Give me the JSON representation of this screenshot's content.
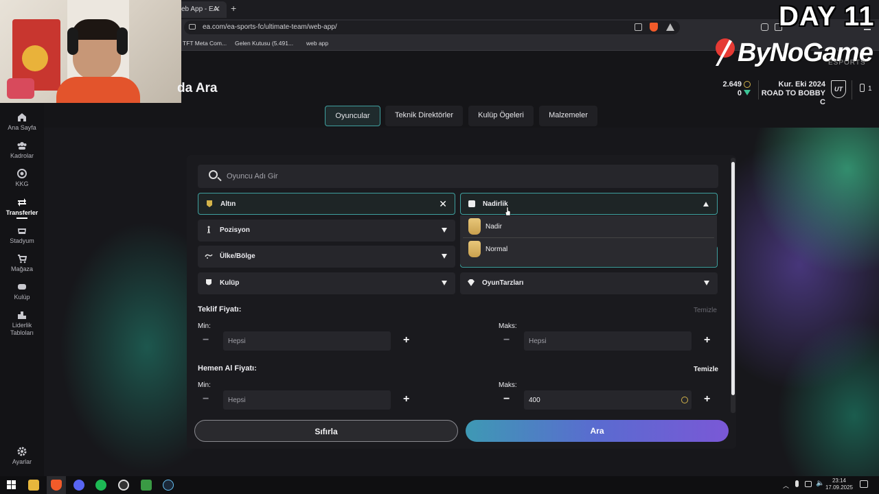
{
  "browser": {
    "tab_title": "eb App - EA",
    "url": "ea.com/ea-sports-fc/ultimate-team/web-app/",
    "bookmarks": [
      "TFT Meta Com...",
      "Gelen Kutusu (5.491...",
      "web app"
    ]
  },
  "overlay": {
    "day_label": "DAY 11",
    "brand": "ByNoGame",
    "brand_sub": "ESPORTS"
  },
  "sidebar": {
    "items": [
      {
        "label": "Ana Sayfa",
        "icon": "home-icon"
      },
      {
        "label": "Kadrolar",
        "icon": "squad-icon"
      },
      {
        "label": "KKG",
        "icon": "sbc-icon"
      },
      {
        "label": "Transferler",
        "icon": "transfer-icon"
      },
      {
        "label": "Stadyum",
        "icon": "stadium-icon"
      },
      {
        "label": "Mağaza",
        "icon": "cart-icon"
      },
      {
        "label": "Kulüp",
        "icon": "club-icon"
      },
      {
        "label": "Liderlik Tabloları",
        "icon": "leaderboard-icon"
      }
    ],
    "settings_label": "Ayarlar"
  },
  "header": {
    "title": "da Ara",
    "coins": "2.649",
    "points": "0",
    "season_line1": "Kur. Eki 2024",
    "season_line2": "ROAD TO BOBBY C",
    "ut_badge": "UT",
    "phone_count": "1"
  },
  "tabs": [
    "Oyuncular",
    "Teknik Direktörler",
    "Kulüp Ögeleri",
    "Malzemeler"
  ],
  "search": {
    "placeholder": "Oyuncu Adı Gir"
  },
  "filters": {
    "quality": "Altın",
    "rarity": "Nadirlik",
    "position": "Pozisyon",
    "nation": "Ülke/Bölge",
    "club": "Kulüp",
    "playstyles": "OyunTarzları"
  },
  "rarity_options": [
    "Nadir",
    "Normal"
  ],
  "bid_price": {
    "title": "Teklif Fiyatı:",
    "clear": "Temizle",
    "min_label": "Min:",
    "max_label": "Maks:",
    "min_value": "Hepsi",
    "max_value": "Hepsi"
  },
  "buy_now_price": {
    "title": "Hemen Al Fiyatı:",
    "clear": "Temizle",
    "min_label": "Min:",
    "max_label": "Maks:",
    "min_value": "Hepsi",
    "max_value": "400"
  },
  "buttons": {
    "reset": "Sıfırla",
    "search": "Ara"
  },
  "taskbar": {
    "time": "23:14",
    "date": "17.09.2025"
  },
  "colors": {
    "accent_teal": "#3fa1a0",
    "gold": "#d4b44a",
    "search_gradient_start": "#3e99b4",
    "search_gradient_end": "#7a58d6"
  }
}
